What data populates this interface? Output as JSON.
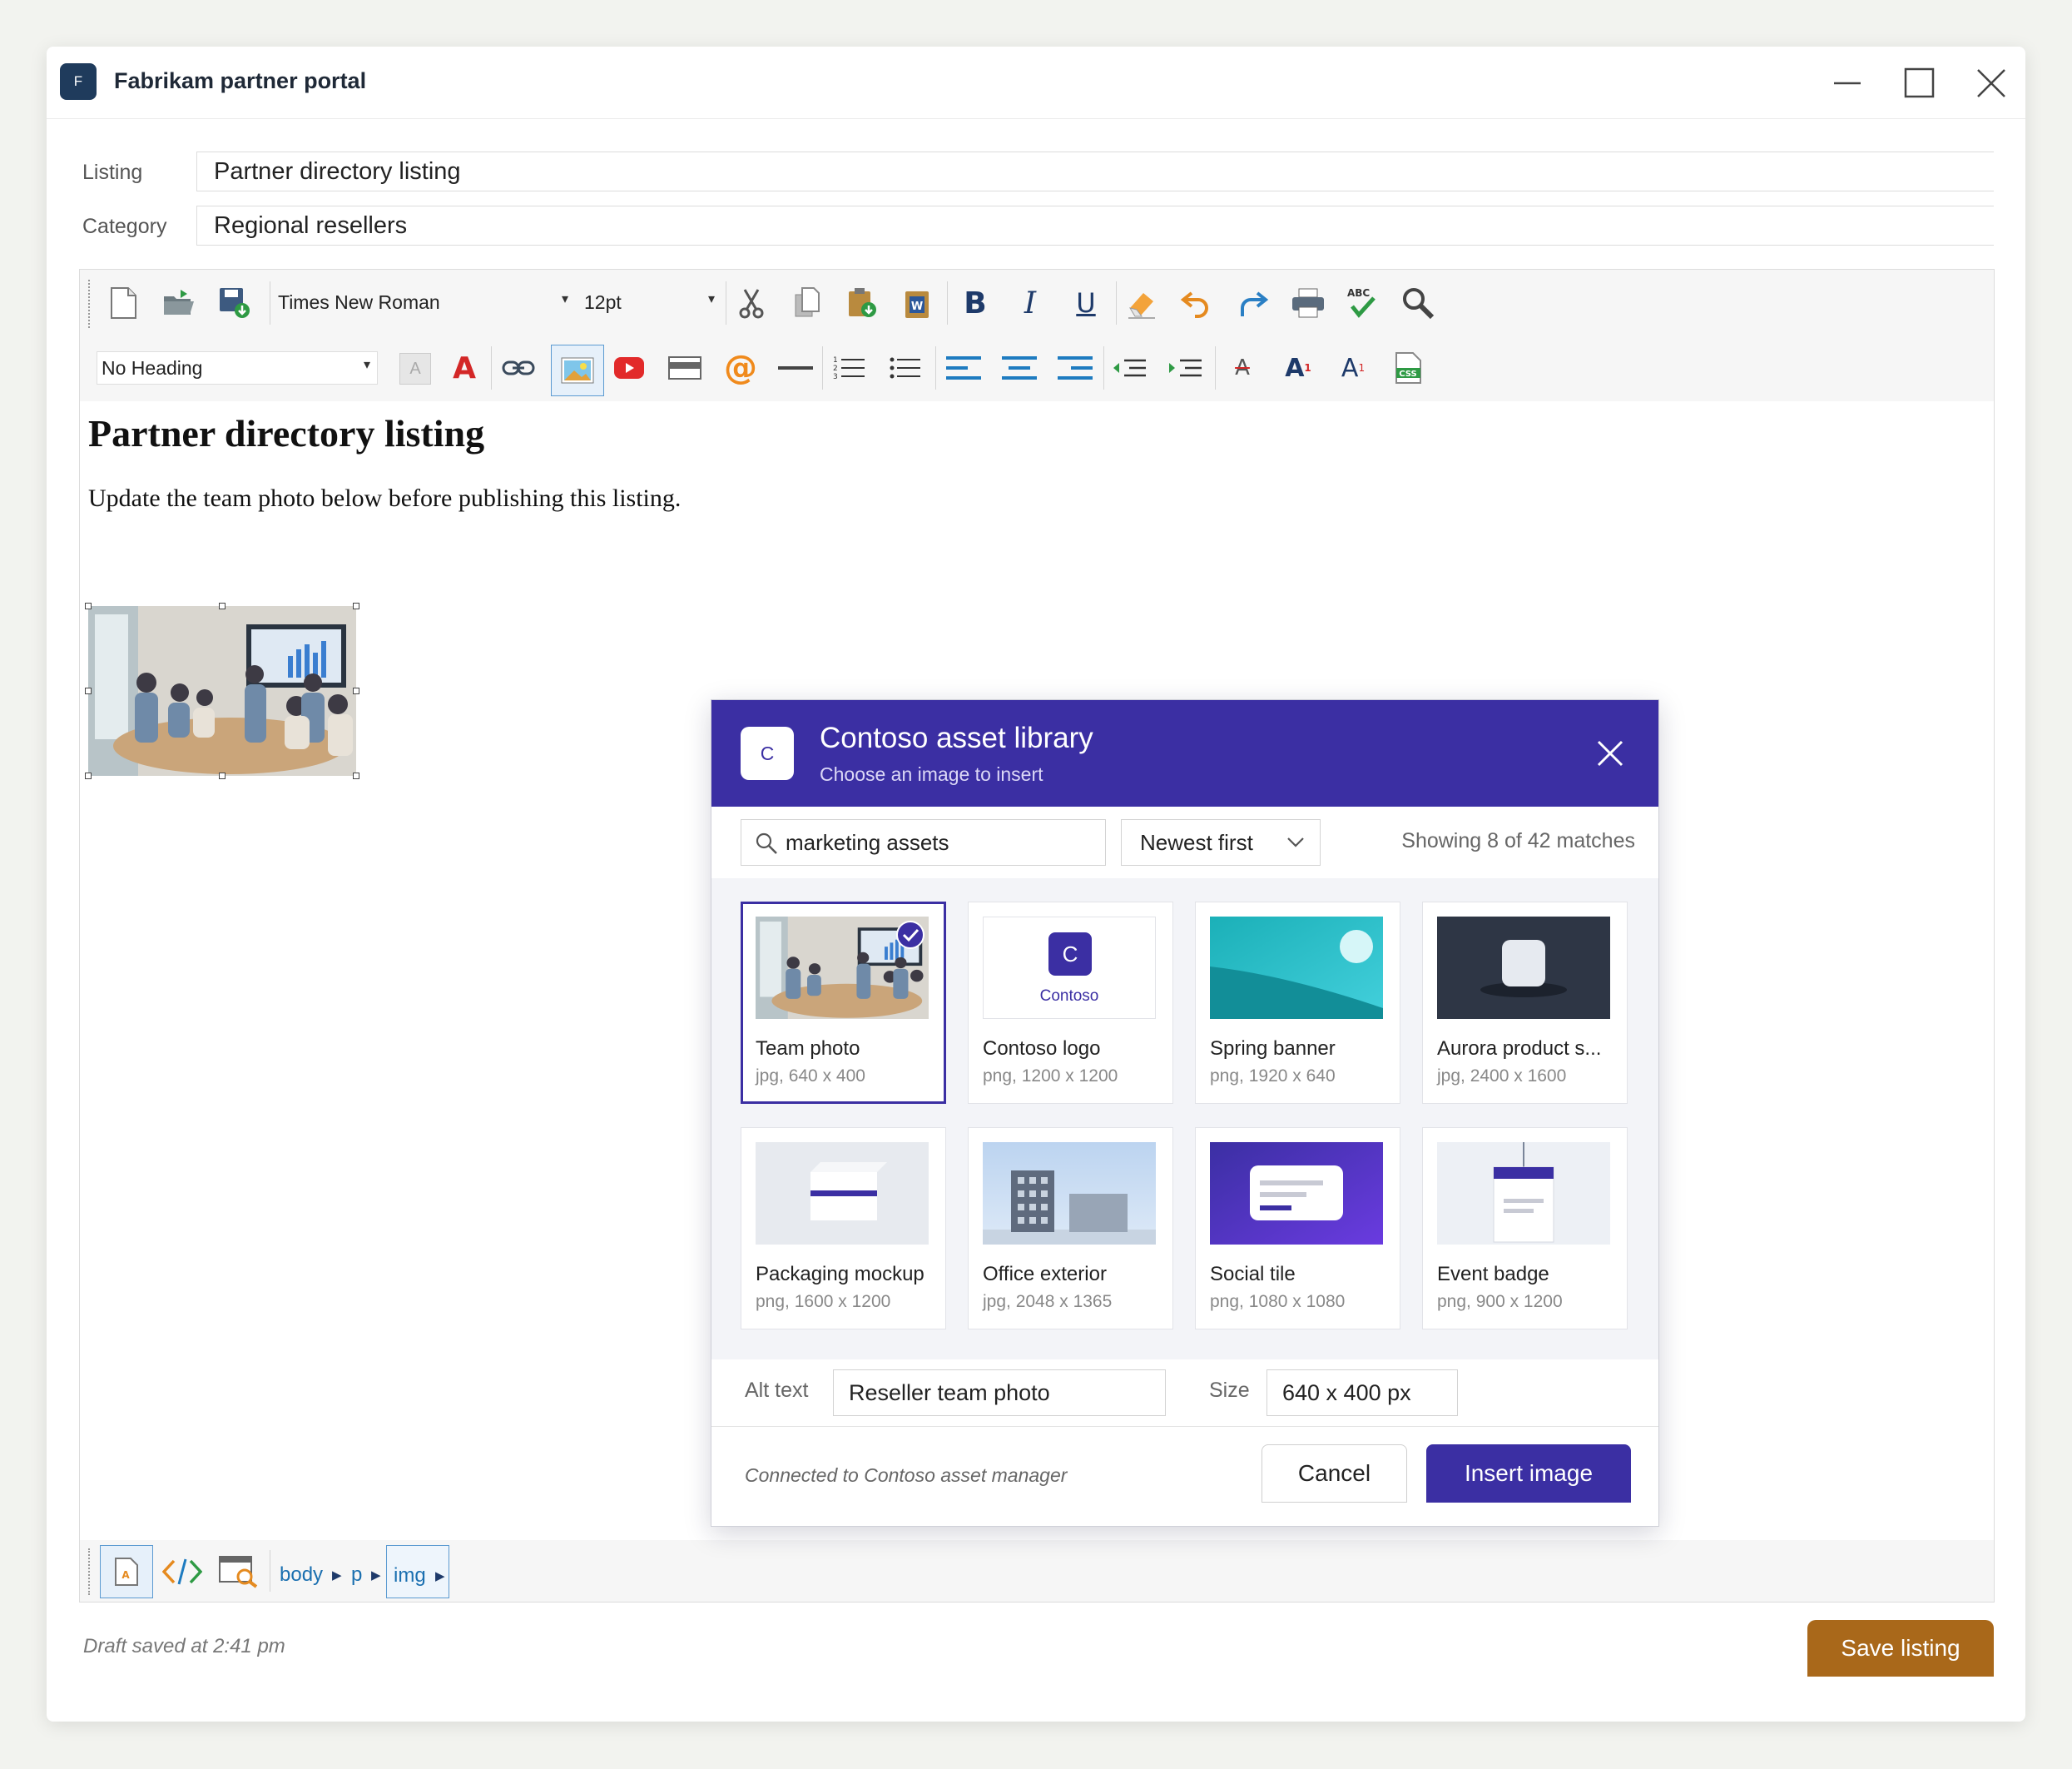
{
  "window": {
    "logo_letter": "F",
    "title": "Fabrikam partner portal"
  },
  "form": {
    "listing_label": "Listing",
    "listing_value": "Partner directory listing",
    "category_label": "Category",
    "category_value": "Regional resellers"
  },
  "toolbar": {
    "font_family": "Times New Roman",
    "font_size": "12pt",
    "heading_style": "No Heading"
  },
  "document": {
    "heading": "Partner directory listing",
    "paragraph": "Update the team photo below before publishing this listing."
  },
  "breadcrumb": [
    "body",
    "p",
    "img"
  ],
  "dialog": {
    "logo_letter": "C",
    "title": "Contoso asset library",
    "subtitle": "Choose an image to insert",
    "search_value": "marketing assets",
    "sort_value": "Newest first",
    "result_count": "Showing 8 of 42 matches",
    "assets": [
      {
        "name": "Team photo",
        "meta": "jpg, 640 x 400",
        "selected": true
      },
      {
        "name": "Contoso logo",
        "meta": "png, 1200 x 1200",
        "logo_letter": "C",
        "logo_text": "Contoso"
      },
      {
        "name": "Spring banner",
        "meta": "png, 1920 x 640"
      },
      {
        "name": "Aurora product s...",
        "meta": "jpg, 2400 x 1600"
      },
      {
        "name": "Packaging mockup",
        "meta": "png, 1600 x 1200"
      },
      {
        "name": "Office exterior",
        "meta": "jpg, 2048 x 1365"
      },
      {
        "name": "Social tile",
        "meta": "png, 1080 x 1080"
      },
      {
        "name": "Event badge",
        "meta": "png, 900 x 1200"
      }
    ],
    "alt_text_label": "Alt text",
    "alt_text_value": "Reseller team photo",
    "size_label": "Size",
    "size_value": "640 x 400 px",
    "status": "Connected to Contoso asset manager",
    "cancel_label": "Cancel",
    "insert_label": "Insert image"
  },
  "footer": {
    "draft_status": "Draft saved at 2:41 pm",
    "save_label": "Save listing"
  },
  "colors": {
    "dialog_accent": "#3b2fa3",
    "save_button": "#a9681a",
    "app_logo": "#1f3b5c"
  }
}
